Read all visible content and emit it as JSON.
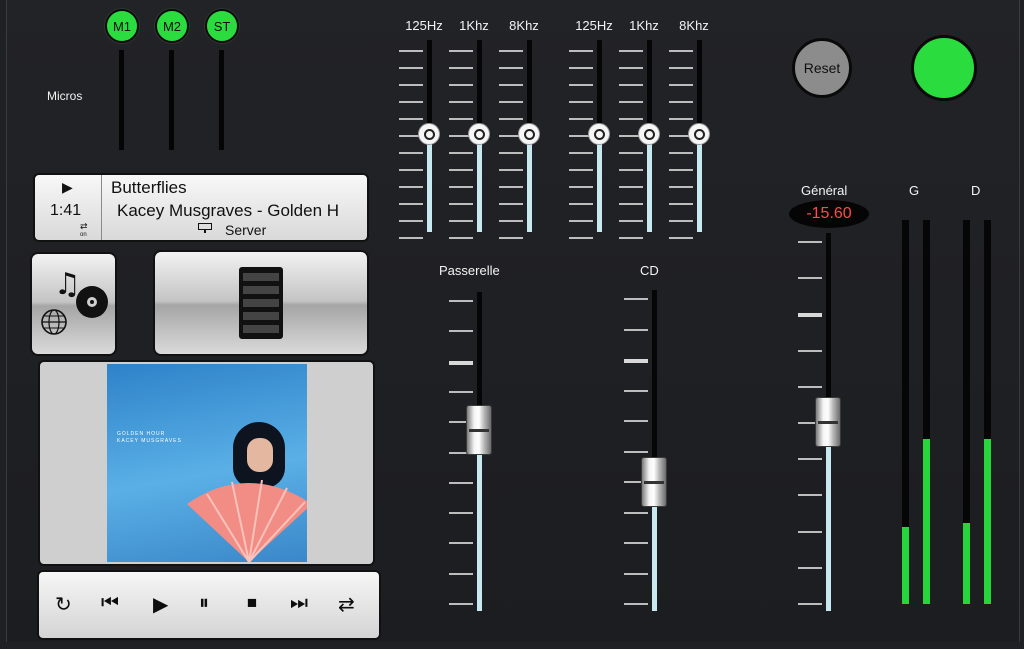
{
  "mic_buttons": [
    {
      "label": "M1",
      "color": "#2bdc3f"
    },
    {
      "label": "M2",
      "color": "#2bdc3f"
    },
    {
      "label": "ST",
      "color": "#2bdc3f"
    }
  ],
  "micros_label": "Micros",
  "eq_bands": [
    "125Hz",
    "1Khz",
    "8Khz",
    "125Hz",
    "1Khz",
    "8Khz"
  ],
  "reset_label": "Reset",
  "status_led_color": "#2bdc3f",
  "now_playing": {
    "play_icon": "play-icon",
    "time": "1:41",
    "shuffle_state": "on",
    "title": "Butterflies",
    "subtitle": "Kacey Musgraves - Golden H",
    "source": "Server"
  },
  "album_art": {
    "line1": "GOLDEN HOUR",
    "line2": "KACEY MUSGRAVES"
  },
  "channels": {
    "passerelle": "Passerelle",
    "cd": "CD",
    "general": "Général",
    "general_value": "-15.60"
  },
  "meters": {
    "g_label": "G",
    "d_label": "D",
    "levels": [
      0.2,
      0.43,
      0.21,
      0.43
    ]
  },
  "transport": [
    "repeat-icon",
    "previous-icon",
    "play-icon",
    "pause-icon",
    "stop-icon",
    "next-icon",
    "shuffle-icon"
  ]
}
